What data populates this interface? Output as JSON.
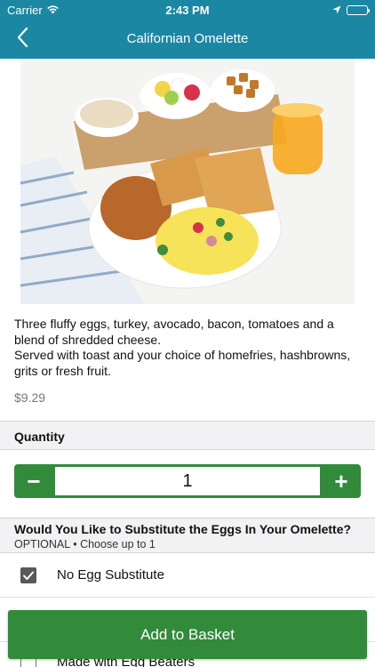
{
  "status_bar": {
    "carrier": "Carrier",
    "time": "2:43 PM",
    "icons": [
      "wifi-icon",
      "location-arrow-icon",
      "battery-icon"
    ]
  },
  "nav": {
    "title": "Californian Omelette",
    "back_icon": "chevron-left-icon"
  },
  "item": {
    "image_alt": "Californian Omelette plate",
    "description_line1": "Three fluffy eggs, turkey, avocado, bacon, tomatoes and a blend of shredded cheese.",
    "description_line2": "Served with toast and your choice of homefries, hashbrowns, grits or fresh fruit.",
    "price": "$9.29"
  },
  "quantity": {
    "heading": "Quantity",
    "value": "1",
    "minus": "−",
    "plus": "+"
  },
  "substitution": {
    "question": "Would You Like to Substitute the Eggs In Your Omelette?",
    "meta": "OPTIONAL • Choose up to 1",
    "options": [
      {
        "label": "No Egg Substitute",
        "checked": true
      },
      {
        "label": "Made with Egg Beaters",
        "checked": false
      }
    ]
  },
  "cta": {
    "add_to_basket": "Add to Basket"
  },
  "colors": {
    "nav_teal": "#1b87a3",
    "action_green": "#328a3b",
    "section_gray": "#f2f2f4"
  }
}
